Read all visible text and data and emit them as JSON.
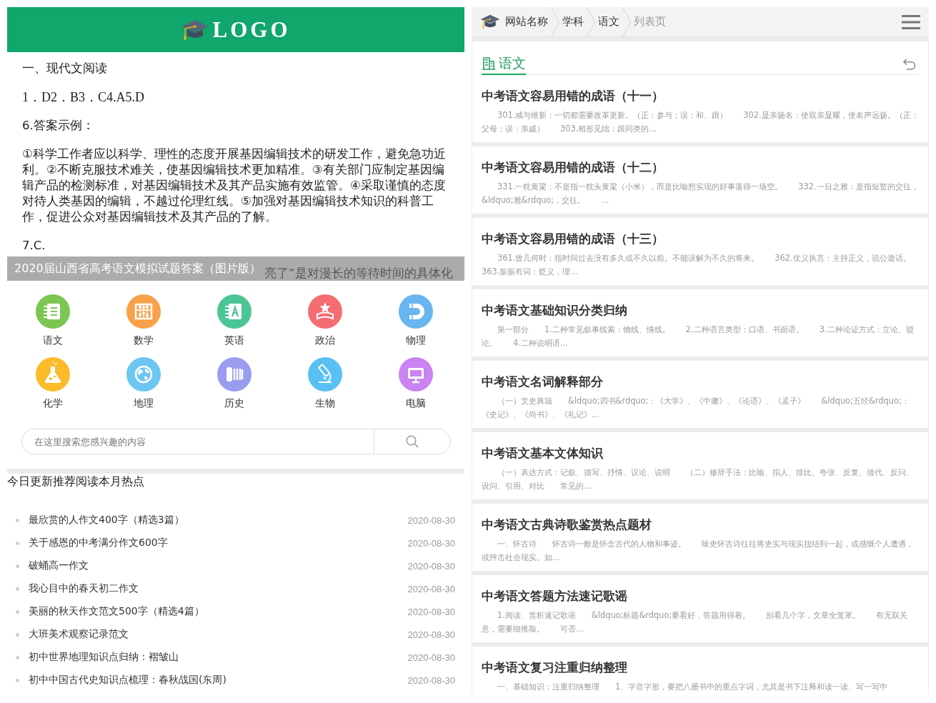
{
  "left_panel": {
    "header": {
      "logo": "LOGO"
    },
    "slide": {
      "lines": [
        {
          "kind": "sans",
          "text": "一、现代文阅读"
        },
        {
          "kind": "serif",
          "text": "1．D2．B3．C4.A5.D"
        },
        {
          "kind": "sans",
          "text": "6.答案示例："
        },
        {
          "kind": "sans",
          "text": "①科学工作者应以科学、理性的态度开展基因编辑技术的研发工作，避免急功近利。②不断克服技术难关，使基因编辑技术更加精准。③有关部门应制定基因编辑产品的检测标准，对基因编辑技术及其产品实施有效监管。④采取谨慎的态度对待人类基因的编辑，不越过伦理红线。⑤加强对基因编辑技术知识的科普工作，促进公众对基因编辑技术及其产品的了解。"
        },
        {
          "kind": "sans",
          "text": "7.C."
        }
      ],
      "covered_line": "亮了”是对漫长的等待时间的具体化",
      "caption": "2020届山西省高考语文模拟试题答案（图片版）"
    },
    "subjects": [
      {
        "label": "语文",
        "color": "#7cc652"
      },
      {
        "label": "数学",
        "color": "#f9a04a"
      },
      {
        "label": "英语",
        "color": "#4bc594"
      },
      {
        "label": "政治",
        "color": "#f46d73"
      },
      {
        "label": "物理",
        "color": "#67b6f0"
      },
      {
        "label": "化学",
        "color": "#fbbb2a"
      },
      {
        "label": "地理",
        "color": "#6cc6f1"
      },
      {
        "label": "历史",
        "color": "#9a9cf0"
      },
      {
        "label": "生物",
        "color": "#58c0f3"
      },
      {
        "label": "电脑",
        "color": "#c983f2"
      }
    ],
    "search": {
      "placeholder": "在这里搜索您感兴趣的内容"
    },
    "list_heading": "今日更新推荐阅读本月热点",
    "articles": [
      {
        "title": "最欣赏的人作文400字（精选3篇）",
        "date": "2020-08-30"
      },
      {
        "title": "关于感恩的中考满分作文600字",
        "date": "2020-08-30"
      },
      {
        "title": "破蛹高一作文",
        "date": "2020-08-30"
      },
      {
        "title": "我心目中的春天初二作文",
        "date": "2020-08-30"
      },
      {
        "title": "美丽的秋天作文范文500字（精选4篇）",
        "date": "2020-08-30"
      },
      {
        "title": "大班美术观察记录范文",
        "date": "2020-08-30"
      },
      {
        "title": "初中世界地理知识点归纳：褶皱山",
        "date": "2020-08-30"
      },
      {
        "title": "初中中国古代史知识点梳理：春秋战国(东周)",
        "date": "2020-08-30"
      }
    ]
  },
  "right_panel": {
    "breadcrumb": [
      {
        "label": "网站名称",
        "current": false
      },
      {
        "label": "学科",
        "current": false
      },
      {
        "label": "语文",
        "current": false
      },
      {
        "label": "列表页",
        "current": true
      }
    ],
    "section": {
      "title": "语文"
    },
    "articles": [
      {
        "title": "中考语文容易用错的成语（十一）",
        "excerpt": "　　301.咸与维新：一切都需要改革更新。（正：参与；误：和、跟）　　302.显亲扬名：使双亲显耀，使名声远扬。（正：父母；误：亲戚）　　303.相形见绌：跟同类的..."
      },
      {
        "title": "中考语文容易用错的成语（十二）",
        "excerpt": "　　331.一枕黄粱：不是指一枕头黄粱（小米），而是比喻想实现的好事落得一场空。　　332.一日之雅：是指短暂的交往，&ldquo;雅&rdquo;，交往。　　..."
      },
      {
        "title": "中考语文容易用错的成语（十三）",
        "excerpt": "　　361.曾几何时：指时间过去没有多久或不久以前。不能误解为不久的将来。　　362.仗义执言：主持正义，说公道话。　　363.振振有词：贬义，理..."
      },
      {
        "title": "中考语文基础知识分类归纳",
        "excerpt": "　　第一部分　　1.二种常见叙事线索：物线、情线。　　2.二种语言类型：口语、书面语。　　3.二种论证方式：立论、驳论。　　4.二种说明语..."
      },
      {
        "title": "中考语文名词解释部分",
        "excerpt": "　　（一）文史典籍　　&ldquo;四书&rdquo;：《大学》、《中庸》、《论语》、《孟子》　　&ldquo;五经&rdquo;：《史记》、《尚书》、《礼记》..."
      },
      {
        "title": "中考语文基本文体知识",
        "excerpt": "　　（一）表达方式：记叙、描写、抒情、议论、说明　　（二）修辞手法：比喻、拟人、排比、夸张、反复、借代、反问、设问、引用、对比　　常见的..."
      },
      {
        "title": "中考语文古典诗歌鉴赏热点题材",
        "excerpt": "　　一、怀古诗　　怀古诗一般是怀念古代的人物和事迹。　　咏史怀古诗往往将史实与现实扭结到一起，或感慨个人遭遇，或抨击社会现实。如..."
      },
      {
        "title": "中考语文答题方法速记歌谣",
        "excerpt": "　　1.阅读、赏析速记歌谣　　&ldquo;标题&rdquo;要看好，答题用得着。　　别看几个字，文章全笼罩。　　有无双关意，需要细推敲。　　可否..."
      },
      {
        "title": "中考语文复习注重归纳整理",
        "excerpt": "　　一、基础知识：注重归纳整理　　1、字音字形，要把八册书中的重点字词，尤其是书下注释和读一读、写一写中"
      }
    ]
  }
}
